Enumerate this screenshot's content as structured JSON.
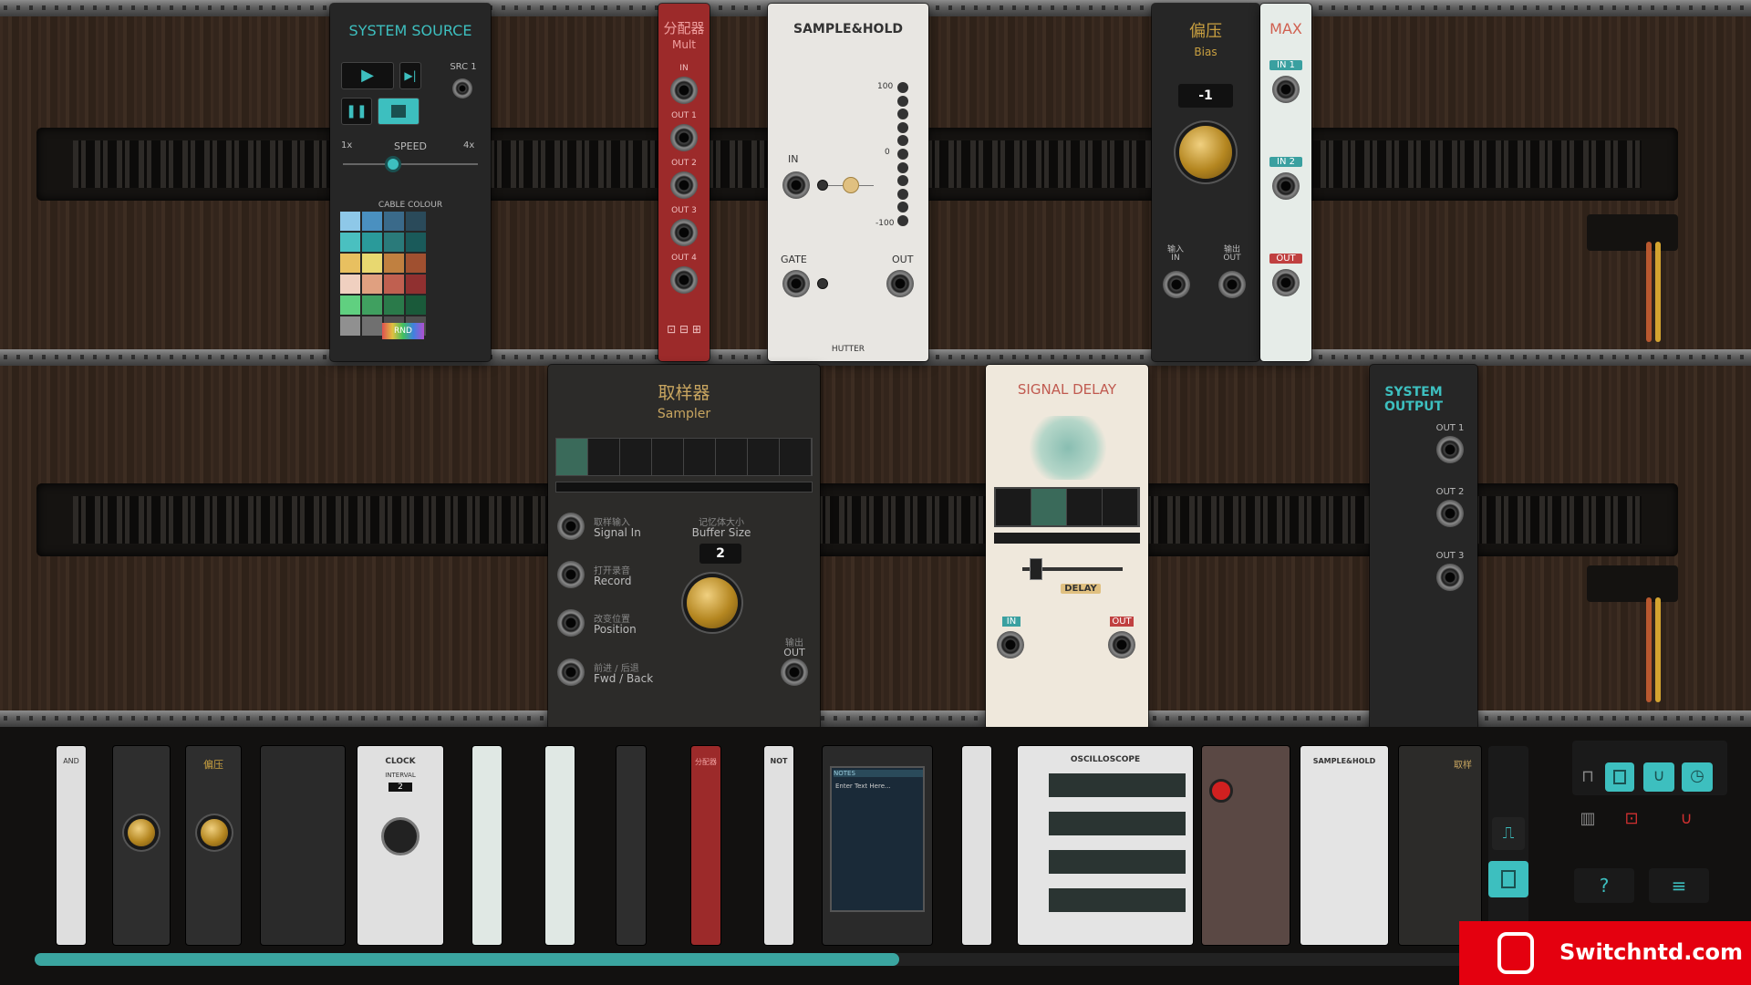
{
  "system_source": {
    "title": "SYSTEM SOURCE",
    "src1": "SRC 1",
    "speed_min": "1x",
    "speed_label": "SPEED",
    "speed_max": "4x",
    "cable_colour": "CABLE COLOUR",
    "rnd": "RND"
  },
  "mult": {
    "title_cn": "分配器",
    "title": "Mult",
    "in": "IN",
    "out1": "OUT 1",
    "out2": "OUT 2",
    "out3": "OUT 3",
    "out4": "OUT 4"
  },
  "sample_hold": {
    "title": "SAMPLE&HOLD",
    "scale_top": "100",
    "scale_mid": "0",
    "scale_bot": "-100",
    "in": "IN",
    "gate": "GATE",
    "out": "OUT",
    "brand": "HUTTER"
  },
  "bias": {
    "title_cn": "偏压",
    "title": "Bias",
    "value": "-1",
    "in_cn": "输入",
    "in": "IN",
    "out_cn": "输出",
    "out": "OUT"
  },
  "max": {
    "title": "MAX",
    "in1": "IN 1",
    "in2": "IN 2",
    "out": "OUT"
  },
  "sampler": {
    "title_cn": "取样器",
    "title": "Sampler",
    "signal_in_cn": "取样输入",
    "signal_in": "Signal In",
    "buffer_cn": "记忆体大小",
    "buffer": "Buffer Size",
    "buffer_value": "2",
    "record_cn": "打开录音",
    "record": "Record",
    "position_cn": "改变位置",
    "position": "Position",
    "fwd_cn": "前进 / 后退",
    "fwd": "Fwd / Back",
    "out_cn": "输出",
    "out": "OUT"
  },
  "signal_delay": {
    "title": "SIGNAL DELAY",
    "delay": "DELAY",
    "in": "IN",
    "out": "OUT"
  },
  "system_output": {
    "title_l1": "SYSTEM",
    "title_l2": "OUTPUT",
    "out1": "OUT 1",
    "out2": "OUT 2",
    "out3": "OUT 3"
  },
  "tray": {
    "clock": "CLOCK",
    "interval": "INTERVAL",
    "interval_value": "2",
    "not": "NOT",
    "oscilloscope": "OSCILLOSCOPE",
    "notes": "NOTES",
    "notes_placeholder": "Enter Text Here...",
    "sample_hold": "SAMPLE&HOLD",
    "and": "AND",
    "bias_cn": "偏压",
    "mult_cn": "分配器",
    "sampler_cn": "取样"
  },
  "watermark": "Switchntd.com",
  "colors": {
    "accent": "#3dbfbf",
    "tray_scroll": "#3aa5a0",
    "mult_red": "#9c2a2a",
    "knob_gold": "#c9a040",
    "watermark_red": "#e4000f"
  }
}
